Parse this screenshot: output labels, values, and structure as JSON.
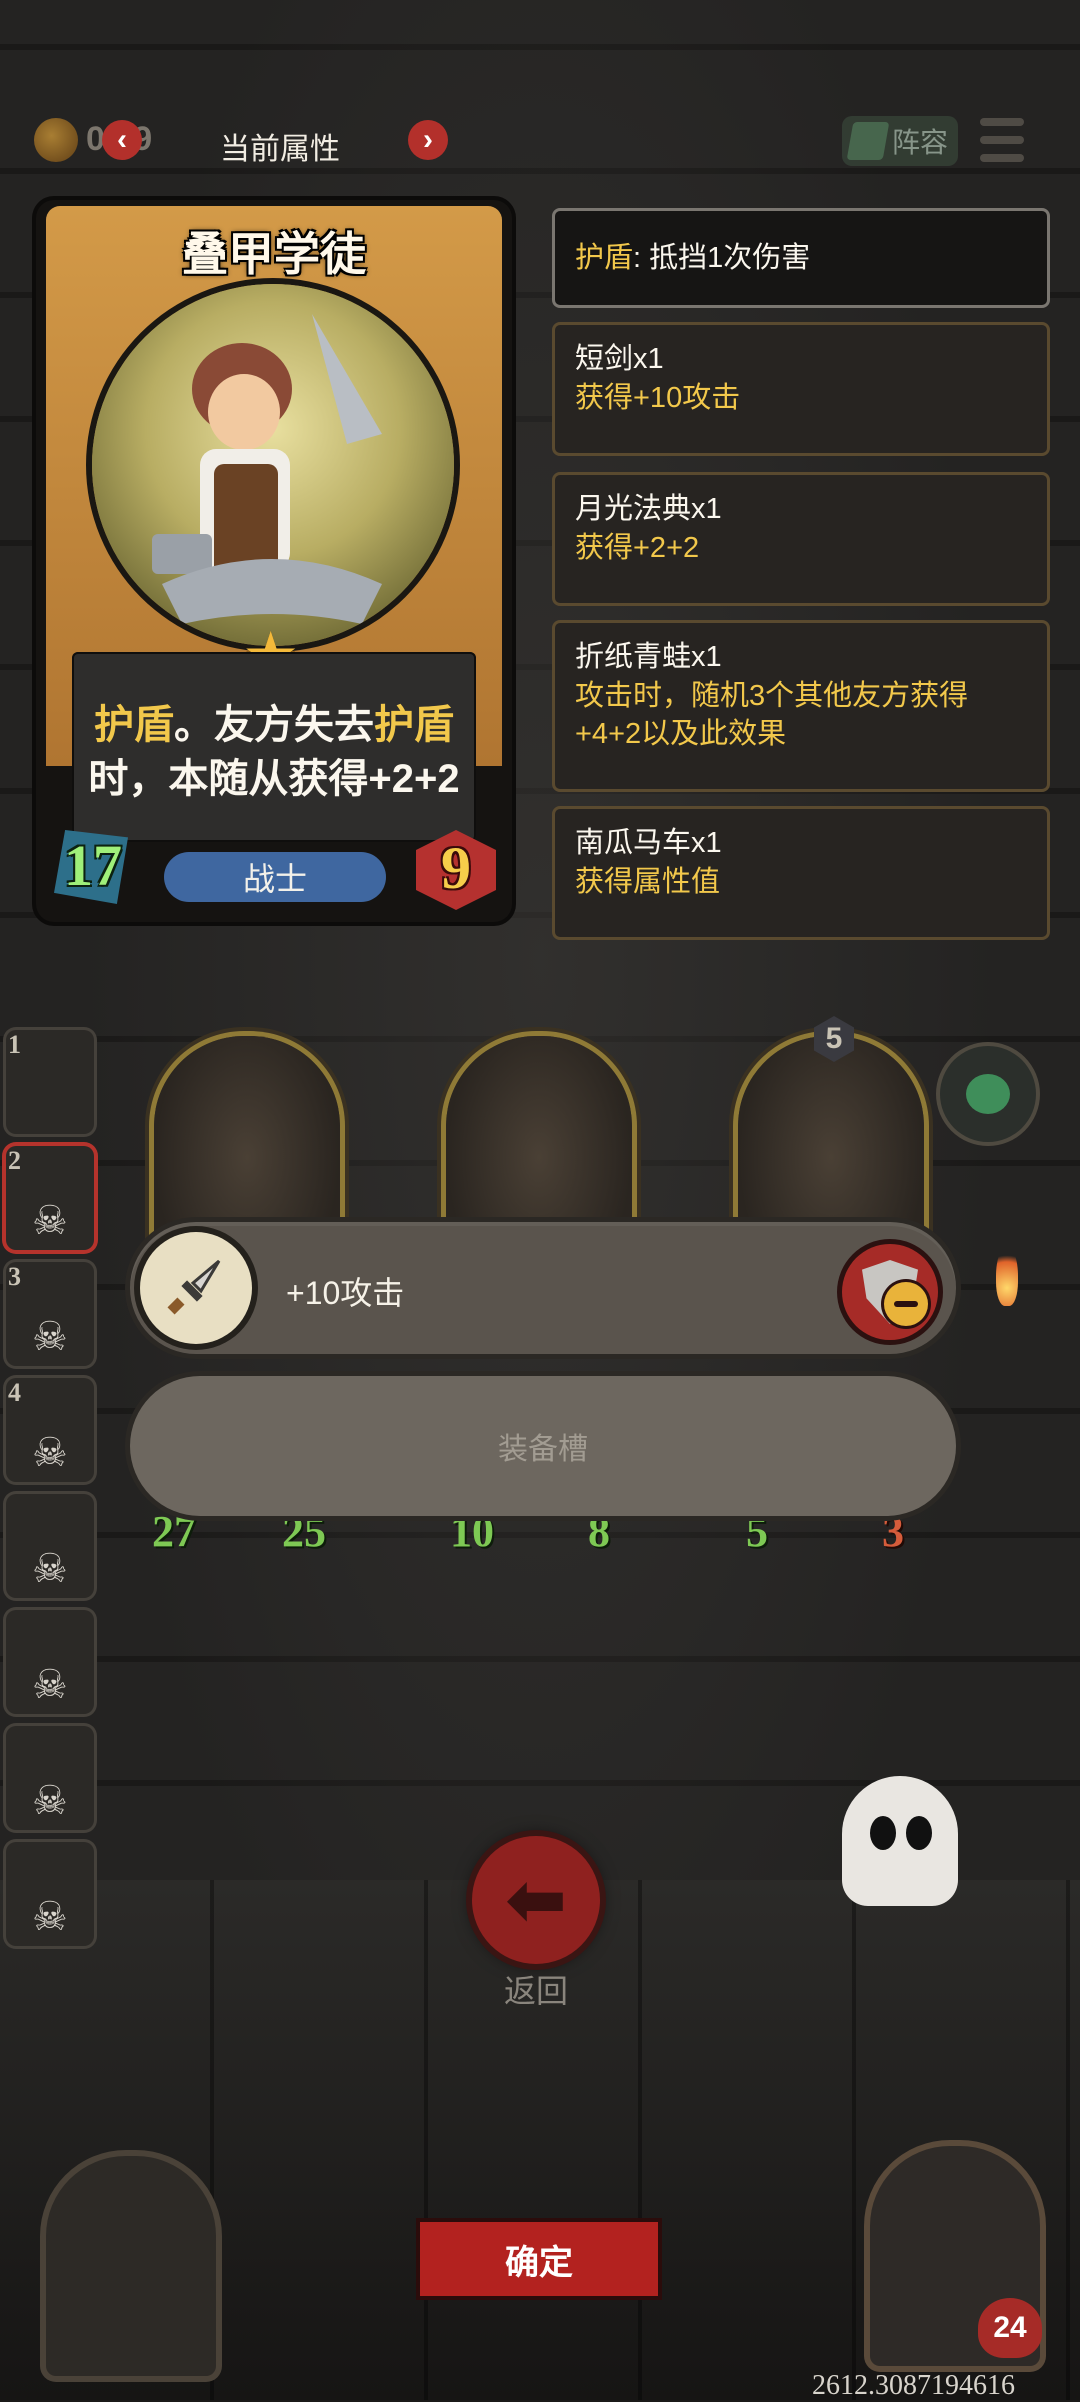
{
  "topbar": {
    "coin_count": "0 19",
    "title": "当前属性",
    "prev_arrow": "‹",
    "next_arrow": "›",
    "lineup_label": "阵容"
  },
  "card": {
    "name": "叠甲学徒",
    "desc_line1_a": "护盾",
    "desc_line1_b": "。友方失去",
    "desc_line1_c": "护盾",
    "desc_line2": "时，本随从获得+2+2",
    "attack": "17",
    "health": "9",
    "class": "战士"
  },
  "info_panels": [
    {
      "title_keyword": "护盾",
      "title_rest": ": 抵挡1次伤害"
    },
    {
      "title": "短剑x1",
      "body": "获得+10攻击"
    },
    {
      "title": "月光法典x1",
      "body": "获得+2+2"
    },
    {
      "title": "折纸青蛙x1",
      "body_line1": "攻击时，随机3个其他友方获得",
      "body_line2": "+4+2以及此效果"
    },
    {
      "title": "南瓜马车x1",
      "body": "获得属性值"
    }
  ],
  "lineup": [
    {
      "attack": "27",
      "health": "25"
    },
    {
      "attack": "10",
      "health": "8"
    },
    {
      "attack": "5",
      "health": "3",
      "level": "5"
    }
  ],
  "side_list": [
    "1",
    "2",
    "3",
    "4",
    "",
    "",
    "",
    ""
  ],
  "equipment": {
    "item_effect": "+10攻击",
    "slot_placeholder": "装备槽"
  },
  "actions": {
    "back_label": "返回",
    "back_icon": "arrow-left-icon",
    "confirm_label": "确定"
  },
  "portrait_health": "24",
  "coords": "2612.3087194616",
  "colors": {
    "gold_text": "#f2c84b",
    "button_red": "#b3221f",
    "card_frame": "#d39a48"
  }
}
